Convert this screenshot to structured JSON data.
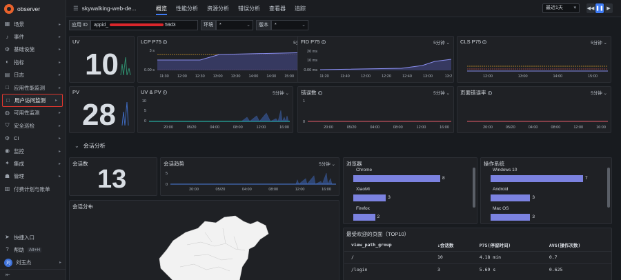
{
  "app": {
    "logo_text": "observer"
  },
  "sidebar": {
    "items": [
      {
        "label": "场景",
        "icon": "dashboard-icon",
        "glyph": "▦"
      },
      {
        "label": "事件",
        "icon": "bell-icon",
        "glyph": "♪"
      },
      {
        "label": "基础设施",
        "icon": "server-icon",
        "glyph": "⚙"
      },
      {
        "label": "指标",
        "icon": "metrics-icon",
        "glyph": "◐"
      },
      {
        "label": "日志",
        "icon": "log-icon",
        "glyph": "▤"
      },
      {
        "label": "应用性能监测",
        "icon": "apm-icon",
        "glyph": "□"
      },
      {
        "label": "用户访问监测",
        "icon": "rum-icon",
        "glyph": "□"
      },
      {
        "label": "可用性监测",
        "icon": "availability-icon",
        "glyph": "◍"
      },
      {
        "label": "安全巡检",
        "icon": "shield-icon",
        "glyph": "⛉"
      },
      {
        "label": "CI",
        "icon": "ci-icon",
        "glyph": "⚙"
      },
      {
        "label": "监控",
        "icon": "monitor-icon",
        "glyph": "◉"
      },
      {
        "label": "集成",
        "icon": "integration-icon",
        "glyph": "✦"
      },
      {
        "label": "管理",
        "icon": "manage-icon",
        "glyph": "☗"
      },
      {
        "label": "付费计划与账单",
        "icon": "billing-icon",
        "glyph": "▥"
      }
    ],
    "bottom": {
      "quick_entry": "快捷入口",
      "help": "帮助",
      "help_shortcut": "Alt+H",
      "user": "刘玉杰",
      "avatar_text": "刘"
    }
  },
  "topbar": {
    "title": "skywalking-web-de...",
    "tabs": [
      "概览",
      "性能分析",
      "资源分析",
      "错误分析",
      "查看器",
      "追踪"
    ],
    "time_range": "最近1天"
  },
  "filters": {
    "app_id_label": "应用 ID",
    "app_id_prefix": "appid_",
    "app_id_suffix": "59d3",
    "env_label": "环境",
    "env_value": "*",
    "version_label": "版本",
    "version_value": "*"
  },
  "panels": {
    "uv": {
      "title": "UV",
      "value": "10"
    },
    "pv": {
      "title": "PV",
      "value": "28"
    },
    "lcp": {
      "title": "LCP P75",
      "menu": "5分钟",
      "y_ticks": [
        "3 s",
        "0.00 s"
      ],
      "x_ticks": [
        "11:30",
        "12:00",
        "12:30",
        "13:00",
        "13:30",
        "14:00",
        "14:30",
        "15:00",
        "15:30"
      ]
    },
    "fid": {
      "title": "FID P75",
      "menu": "5分钟",
      "y_ticks": [
        "20 ms",
        "10 ms",
        "0.00 ms"
      ],
      "x_ticks": [
        "11:20",
        "11:40",
        "12:00",
        "12:20",
        "12:40",
        "13:00",
        "13:2"
      ]
    },
    "cls": {
      "title": "CLS P75",
      "menu": "5分钟",
      "x_ticks": [
        "12:00",
        "13:00",
        "14:00",
        "15:00"
      ]
    },
    "uvpv": {
      "title": "UV & PV",
      "menu": "5分钟",
      "y_ticks": [
        "10",
        "5",
        "0"
      ],
      "x_ticks": [
        "20:00",
        "05/20",
        "04:00",
        "08:00",
        "12:00",
        "16:00"
      ]
    },
    "errors": {
      "title": "错误数",
      "menu": "5分钟",
      "y_ticks": [
        "1",
        "0"
      ],
      "x_ticks": [
        "20:00",
        "05/20",
        "04:00",
        "08:00",
        "12:00",
        "16:00"
      ]
    },
    "error_rate": {
      "title": "页面错误率",
      "menu": "5分钟",
      "x_ticks": [
        "20:00",
        "05/20",
        "04:00",
        "08:00",
        "12:00",
        "16:00"
      ]
    }
  },
  "session": {
    "section_title": "会话分析",
    "count_title": "会话数",
    "count_value": "13",
    "trend_title": "会话趋势",
    "trend_menu": "5分钟",
    "trend_y_ticks": [
      "5",
      "0"
    ],
    "trend_x_ticks": [
      "20:00",
      "05/20",
      "04:00",
      "08:00",
      "12:00",
      "16:00"
    ],
    "map_title": "会话分布"
  },
  "browsers": {
    "title": "浏览器",
    "items": [
      {
        "name": "Chrome",
        "value": 8
      },
      {
        "name": "XiaoMi",
        "value": 3
      },
      {
        "name": "Firefox",
        "value": 2
      }
    ]
  },
  "os": {
    "title": "操作系统",
    "items": [
      {
        "name": "Windows 10",
        "value": 7
      },
      {
        "name": "Android",
        "value": 3
      },
      {
        "name": "Mac OS",
        "value": 3
      }
    ]
  },
  "top_pages": {
    "title": "最受欢迎的页面（TOP10）",
    "columns": [
      "view_path_group",
      "↓会话数",
      "P75(停留时间)",
      "AVG(操作次数)"
    ],
    "rows": [
      [
        "/",
        "10",
        "4.18 min",
        "0.7"
      ],
      [
        "/login",
        "3",
        "5.69 s",
        "0.625"
      ]
    ]
  },
  "colors": {
    "accent": "#3f7cf5",
    "bar": "#7b82e0",
    "line": "#8a8ff0",
    "uvpv_line": "#27d0c0",
    "error_line": "#e85d6a",
    "highlight": "#e0362d"
  }
}
